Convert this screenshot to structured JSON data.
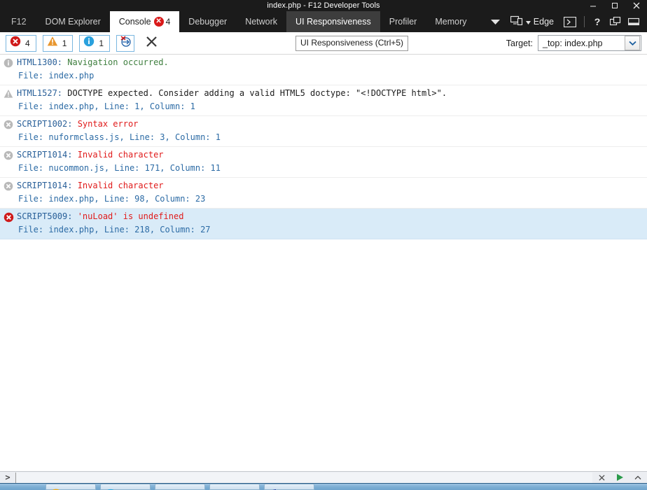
{
  "window": {
    "title": "index.php - F12 Developer Tools",
    "minimize_label": "Minimize",
    "maximize_label": "Maximize",
    "close_label": "Close"
  },
  "tabs": [
    {
      "label": "F12",
      "active": false,
      "badge": null
    },
    {
      "label": "DOM Explorer",
      "active": false,
      "badge": null
    },
    {
      "label": "Console",
      "active": true,
      "badge": "4"
    },
    {
      "label": "Debugger",
      "active": false,
      "badge": null
    },
    {
      "label": "Network",
      "active": false,
      "badge": null
    },
    {
      "label": "UI Responsiveness",
      "active": false,
      "hover": true,
      "badge": null
    },
    {
      "label": "Profiler",
      "active": false,
      "badge": null
    },
    {
      "label": "Memory",
      "active": false,
      "badge": null
    }
  ],
  "tabbar_right": {
    "more_tabs_icon": "chevron-down-icon",
    "emulation_icon": "device-emulation-icon",
    "browser_label": "Edge",
    "console_prompt_icon": "console-prompt-icon",
    "help_icon": "help-icon",
    "dock_icon": "dock-windows-icon",
    "minimize_panel_icon": "minimize-panel-icon"
  },
  "toolbar": {
    "errors_count": "4",
    "warnings_count": "1",
    "info_count": "1",
    "clear_on_navigate_icon": "clear-on-navigate-icon",
    "clear_console_icon": "clear-console-icon",
    "tooltip": "UI Responsiveness (Ctrl+5)",
    "target_label": "Target:",
    "target_value": "_top: index.php",
    "target_options": [
      "_top: index.php"
    ]
  },
  "console": {
    "messages": [
      {
        "level": "info",
        "code": "HTML1300:",
        "text": " Navigation occurred.",
        "detail": "File: index.php"
      },
      {
        "level": "warning",
        "code": "HTML1527:",
        "text": " DOCTYPE expected. Consider adding a valid HTML5 doctype: \"<!DOCTYPE html>\".",
        "detail": "File: index.php, Line: 1, Column: 1"
      },
      {
        "level": "error",
        "code": "SCRIPT1002:",
        "text": " Syntax error",
        "detail": "File: nuformclass.js, Line: 3, Column: 1"
      },
      {
        "level": "error",
        "code": "SCRIPT1014:",
        "text": " Invalid character",
        "detail": "File: nucommon.js, Line: 171, Column: 11"
      },
      {
        "level": "error",
        "code": "SCRIPT1014:",
        "text": " Invalid character",
        "detail": "File: index.php, Line: 98, Column: 23"
      },
      {
        "level": "error",
        "selected": true,
        "code": "SCRIPT5009:",
        "text": " 'nuLoad' is undefined",
        "detail": "File: index.php, Line: 218, Column: 27"
      }
    ]
  },
  "command_bar": {
    "prompt": ">",
    "value": "",
    "placeholder": "",
    "clear_icon": "clear-icon",
    "run_icon": "run-icon",
    "expand_icon": "chevron-up-icon"
  },
  "colors": {
    "chrome_dark": "#1b1b1b",
    "accent_blue": "#2a6099",
    "error_red": "#e01b1b",
    "warning_orange": "#e8962e",
    "info_blue": "#2aa1dd",
    "selected_row": "#d9ebf8"
  }
}
